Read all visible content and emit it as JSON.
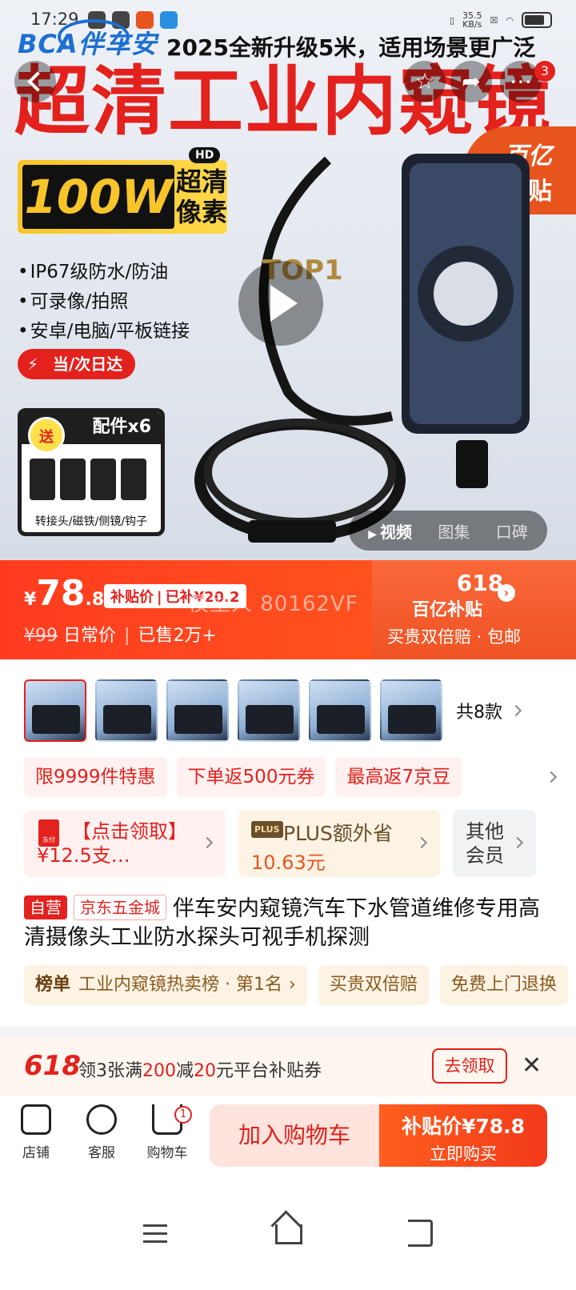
{
  "status": {
    "time": "17:29",
    "net_speed": "35.5\nKB/s"
  },
  "hero": {
    "brand": "BCA伴车安",
    "tagline": "2025全新升级5米，适用场景更广泛",
    "headline": "超清工业内窥镜",
    "subsidy_tag": {
      "line1": "百亿",
      "line2": "补贴"
    },
    "pixel_badge": {
      "hd": "HD",
      "big": "100W",
      "small": "超清像素"
    },
    "features": [
      "IP67级防水/防油",
      "可录像/拍照",
      "安卓/电脑/平板链接"
    ],
    "delivery": "当/次日达",
    "accessory": {
      "gift": "送",
      "title": "配件x6",
      "caption": "转接头/磁铁/侧镜/钩子"
    },
    "top1": "TOP1",
    "share_count": "3",
    "media_tabs": [
      "视频",
      "图集",
      "口碑"
    ]
  },
  "price": {
    "currency": "¥",
    "int": "78",
    "dec": ".8",
    "subsidy_label": "补贴价",
    "subsidy_amount": "已补¥20.2",
    "overlay": "模型人 80162VF",
    "original": "¥99",
    "original_label": "日常价",
    "sold": "已售2万+",
    "promo_618": "618",
    "promo_sub": "百亿补贴",
    "slogan": "买贵双倍赔 · 包邮"
  },
  "variants": {
    "count_label": "共8款",
    "items": 6
  },
  "promos": [
    "限9999件特惠",
    "下单返500元券",
    "最高返7京豆"
  ],
  "coupons": {
    "card1": {
      "icon": "东付",
      "text": "【点击领取】¥12.5支…"
    },
    "card2": {
      "plus": "PLUS",
      "line1": "PLUS额外省",
      "line2": "10.63元"
    },
    "card3": {
      "text": "其他会员"
    }
  },
  "title": {
    "tag_self": "自营",
    "tag_store": "京东五金城",
    "text": "伴车安内窥镜汽车下水管道维修专用高清摄像头工业防水探头可视手机探测"
  },
  "ranks": [
    {
      "label": "榜单",
      "text": "工业内窥镜热卖榜 · 第1名"
    },
    {
      "label": "",
      "text": "买贵双倍赔"
    },
    {
      "label": "",
      "text": "免费上门退换"
    }
  ],
  "coupon_banner": {
    "badge": "618",
    "pre": "领3张满",
    "num1": "200",
    "mid": "减",
    "num2": "20",
    "post": "元平台补贴券",
    "button": "去领取",
    "close": "✕"
  },
  "bottom_bar": {
    "store": "店铺",
    "service": "客服",
    "cart": "购物车",
    "cart_badge": "1",
    "add_to_cart": "加入购物车",
    "buy_price": "补贴价¥78.8",
    "buy_now": "立即购买"
  },
  "colors": {
    "accent": "#e3211d",
    "orange": "#ff5e1e",
    "gold": "#f7c52a"
  }
}
